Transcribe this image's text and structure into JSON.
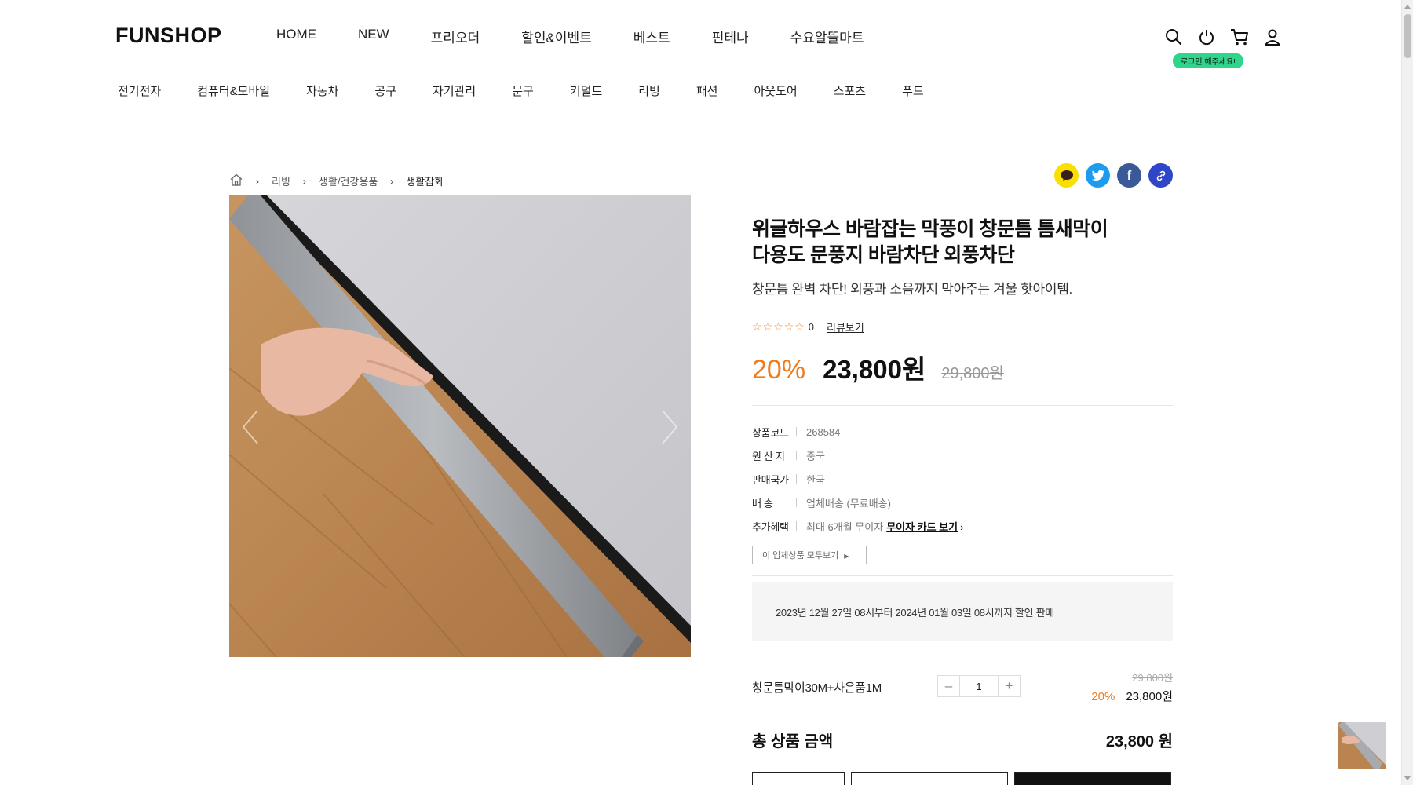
{
  "header": {
    "logo": "FUNSHOP",
    "gnb": [
      "HOME",
      "NEW",
      "프리오더",
      "할인&이벤트",
      "베스트",
      "펀테나",
      "수요알뜰마트"
    ],
    "login_badge": "로그인 해주세요!",
    "categories": [
      "전기전자",
      "컴퓨터&모바일",
      "자동차",
      "공구",
      "자기관리",
      "문구",
      "키덜트",
      "리빙",
      "패션",
      "아웃도어",
      "스포츠",
      "푸드"
    ]
  },
  "breadcrumb": [
    "리빙",
    "생활/건강용품",
    "생활잡화"
  ],
  "product": {
    "title_line1": "위글하우스 바람잡는 막풍이 창문틈 틈새막이",
    "title_line2": "다용도 문풍지 바람차단 외풍차단",
    "subtitle": "창문틈 완벽 차단! 외풍과 소음까지 막아주는 겨울 핫아이템.",
    "stars": "☆☆☆☆☆",
    "review_count": "0",
    "review_link": "리뷰보기",
    "discount": "20%",
    "sale_price": "23,800원",
    "original_price": "29,800원",
    "specs": [
      {
        "k": "상품코드",
        "v": "268584"
      },
      {
        "k": "원 산 지",
        "v": "중국"
      },
      {
        "k": "판매국가",
        "v": "한국"
      },
      {
        "k": "배 송",
        "v": "업체배송 (무료배송)"
      },
      {
        "k": "추가혜택",
        "v": "최대 6개월 무이자",
        "link": "무이자 카드 보기"
      }
    ],
    "vendor_button": "이 업체상품 모두보기",
    "notice": "2023년 12월 27일 08시부터 2024년 01월 03일 08시까지 할인 판매"
  },
  "option": {
    "name": "창문틈막이30M+사은품1M",
    "qty": "1",
    "orig": "29,800원",
    "discount": "20%",
    "price": "23,800원"
  },
  "total": {
    "label": "총 상품 금액",
    "value": "23,800 원"
  },
  "colors": {
    "accent_orange": "#f07b1d",
    "login_green": "#2ed58a",
    "kakao": "#f9e000",
    "twitter": "#1d9bf0",
    "facebook": "#3b5998",
    "link": "#2f46c8"
  }
}
